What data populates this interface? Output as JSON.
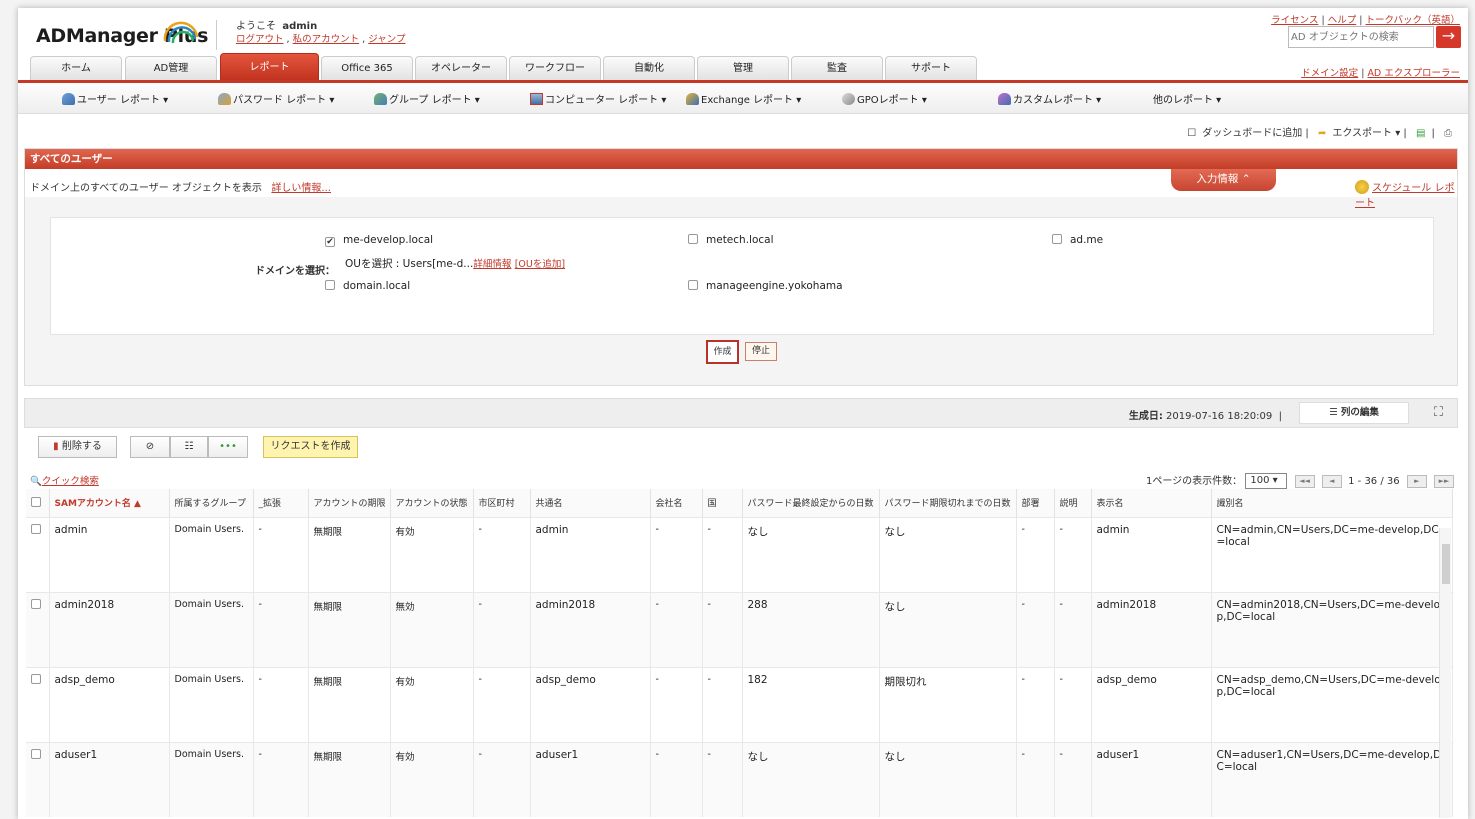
{
  "header": {
    "logo": "ADManager Plus",
    "welcome": "ようこそ",
    "username": "admin",
    "logout": "ログアウト",
    "my_account": "私のアカウント",
    "jump": "ジャンプ",
    "sep": ","
  },
  "toplinks": {
    "license": "ライセンス",
    "help": "ヘルプ",
    "feedback": "トークバック（英語）",
    "pipe": "|"
  },
  "search": {
    "placeholder": "AD オブジェクトの検索",
    "go": "→"
  },
  "tabs": [
    "ホーム",
    "AD管理",
    "レポート",
    "Office 365",
    "オペレーター",
    "ワークフロー",
    "自動化",
    "管理",
    "監査",
    "サポート"
  ],
  "domain_links": {
    "settings": "ドメイン設定",
    "explorer": "AD エクスプローラー",
    "pipe": "|"
  },
  "subnav": [
    "ユーザー レポート ▾",
    "パスワード レポート ▾",
    "グループ レポート ▾",
    "コンピューター レポート ▾",
    "Exchange レポート ▾",
    "GPOレポート ▾",
    "カスタムレポート ▾",
    "他のレポート ▾"
  ],
  "actions": {
    "dashboard": "ダッシュボードに追加 |",
    "export": "エクスポート ▾ |",
    "pipe": "|"
  },
  "report": {
    "title": "すべてのユーザー",
    "description": "ドメイン上のすべてのユーザー オブジェクトを表示",
    "details": "詳しい情報...",
    "input_info": "入力情報 ⌃",
    "schedule": "スケジュール レポート"
  },
  "domains": {
    "label": "ドメインを選択：",
    "items": [
      "me-develop.local",
      "metech.local",
      "ad.me",
      "domain.local",
      "manageengine.yokohama"
    ],
    "checked": "✔",
    "ou_prefix": "OUを選択 : Users[me-d...",
    "ou_details": "詳細情報",
    "ou_add": "[OUを追加]"
  },
  "buttons": {
    "generate": "作成",
    "stop": "停止",
    "delete": "削除する",
    "block": "⊘",
    "icon2": "☷",
    "more": "•••",
    "request": "リクエストを作成"
  },
  "results": {
    "generated_label": "生成日:",
    "generated_value": "2019-07-16 18:20:09",
    "pipe": "|",
    "column_edit": "列の編集",
    "expand": "⛶",
    "quick_search": "クイック検索",
    "per_page_label": "1ページの表示件数：",
    "per_page": "100 ▾",
    "range": "1 - 36 / 36",
    "pg_first": "◄◄",
    "pg_prev": "◄",
    "pg_next": "►",
    "pg_last": "►►"
  },
  "table": {
    "headers": [
      "SAMアカウント名 ▲",
      "所属するグループ",
      "_拡張",
      "アカウントの期限",
      "アカウントの状態",
      "市区町村",
      "共通名",
      "会社名",
      "国",
      "パスワード最終設定からの日数",
      "パスワード期限切れまでの日数",
      "部署",
      "説明",
      "表示名",
      "識別名"
    ],
    "rows": [
      [
        "admin",
        "Domain Users.",
        "-",
        "無期限",
        "有効",
        "-",
        "admin",
        "-",
        "-",
        "なし",
        "なし",
        "-",
        "-",
        "admin",
        "CN=admin,CN=Users,DC=me-develop,DC=local"
      ],
      [
        "admin2018",
        "Domain Users.",
        "-",
        "無期限",
        "無効",
        "-",
        "admin2018",
        "-",
        "-",
        "288",
        "なし",
        "-",
        "-",
        "admin2018",
        "CN=admin2018,CN=Users,DC=me-develop,DC=local"
      ],
      [
        "adsp_demo",
        "Domain Users.",
        "-",
        "無期限",
        "有効",
        "-",
        "adsp_demo",
        "-",
        "-",
        "182",
        "期限切れ",
        "-",
        "-",
        "adsp_demo",
        "CN=adsp_demo,CN=Users,DC=me-develop,DC=local"
      ],
      [
        "aduser1",
        "Domain Users.",
        "-",
        "無期限",
        "有効",
        "-",
        "aduser1",
        "-",
        "-",
        "なし",
        "なし",
        "-",
        "-",
        "aduser1",
        "CN=aduser1,CN=Users,DC=me-develop,DC=local"
      ]
    ]
  }
}
